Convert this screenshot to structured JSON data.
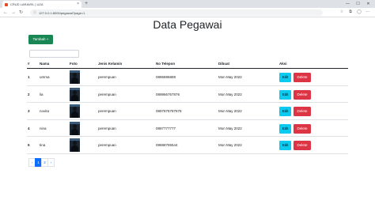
{
  "browser": {
    "tab_title": "CRUD LARAVEL | UZA",
    "tab_close": "×",
    "new_tab": "+",
    "url": "127.0.0.1:8000/pegawai?page=1",
    "minimize": "—",
    "maximize": "☐",
    "close": "✕",
    "back": "←",
    "forward": "→",
    "reload": "↻",
    "lock": "ⓘ"
  },
  "page": {
    "title": "Data Pegawai",
    "add_button": "Tambah +",
    "search": {
      "value": "",
      "placeholder": ""
    }
  },
  "table": {
    "headers": [
      "#",
      "Nama",
      "Foto",
      "Jenis Kelamin",
      "No Telepon",
      "Dibuat",
      "Aksi"
    ],
    "rows": [
      {
        "no": "1",
        "nama": "umma",
        "jenis_kelamin": "perempuan",
        "telepon": "0896896889",
        "dibuat": "Mon May 2022",
        "edit": "Edit",
        "delete": "Delete"
      },
      {
        "no": "2",
        "nama": "lia",
        "jenis_kelamin": "perempuan",
        "telepon": "089866767876",
        "dibuat": "Mon May 2022",
        "edit": "Edit",
        "delete": "Delete"
      },
      {
        "no": "3",
        "nama": "novita",
        "jenis_kelamin": "perempuan",
        "telepon": "0897878787878",
        "dibuat": "Mon May 2022",
        "edit": "Edit",
        "delete": "Delete"
      },
      {
        "no": "4",
        "nama": "nina",
        "jenis_kelamin": "perempuan",
        "telepon": "0897777777",
        "dibuat": "Mon May 2022",
        "edit": "Edit",
        "delete": "Delete"
      },
      {
        "no": "5",
        "nama": "tina",
        "jenis_kelamin": "perempuan",
        "telepon": "09888765544",
        "dibuat": "Mon May 2022",
        "edit": "Edit",
        "delete": "Delete"
      }
    ]
  },
  "pagination": {
    "prev": "‹",
    "pages": [
      "1",
      "2"
    ],
    "active": "1",
    "next": "›"
  },
  "colors": {
    "tambah": "#198754",
    "edit": "#0dcaf0",
    "delete": "#dc3545",
    "page_active": "#0d6efd"
  }
}
